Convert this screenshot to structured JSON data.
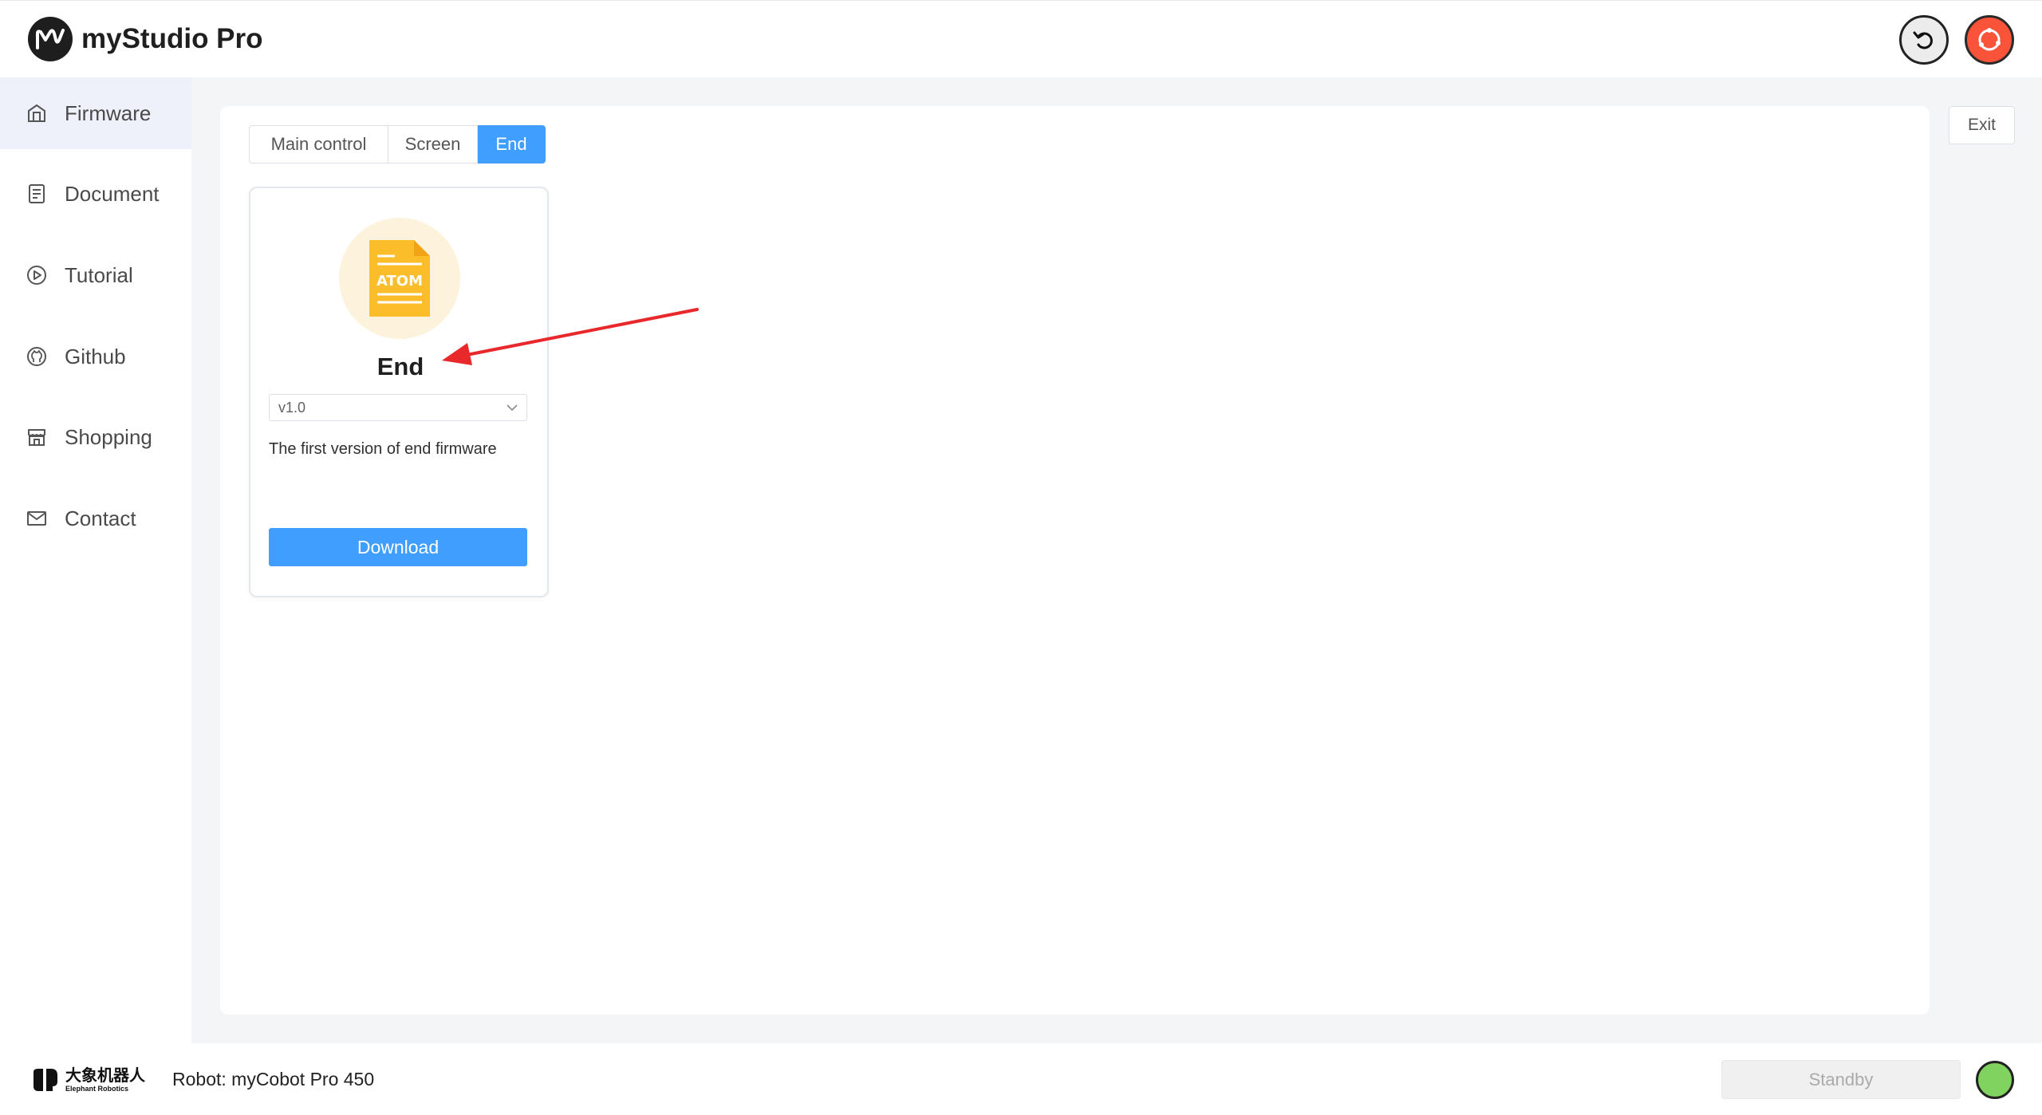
{
  "app": {
    "title": "myStudio Pro"
  },
  "sidebar": {
    "items": [
      {
        "label": "Firmware",
        "icon": "firmware-icon",
        "active": true
      },
      {
        "label": "Document",
        "icon": "document-icon",
        "active": false
      },
      {
        "label": "Tutorial",
        "icon": "play-circle-icon",
        "active": false
      },
      {
        "label": "Github",
        "icon": "github-icon",
        "active": false
      },
      {
        "label": "Shopping",
        "icon": "shop-icon",
        "active": false
      },
      {
        "label": "Contact",
        "icon": "mail-icon",
        "active": false
      }
    ]
  },
  "tabs": [
    {
      "label": "Main control",
      "active": false
    },
    {
      "label": "Screen",
      "active": false
    },
    {
      "label": "End",
      "active": true
    }
  ],
  "exit_label": "Exit",
  "card": {
    "icon_text": "ATOM",
    "title": "End",
    "version": "v1.0",
    "description": "The first version of end firmware",
    "download_label": "Download"
  },
  "footer": {
    "brand_cn": "大象机器人",
    "brand_en": "Elephant Robotics",
    "robot_label": "Robot: myCobot Pro 450",
    "standby_label": "Standby"
  },
  "colors": {
    "accent": "#409eff",
    "status_ok": "#7fd35e",
    "power": "#f9533a",
    "annotation_arrow": "#e8282b"
  }
}
